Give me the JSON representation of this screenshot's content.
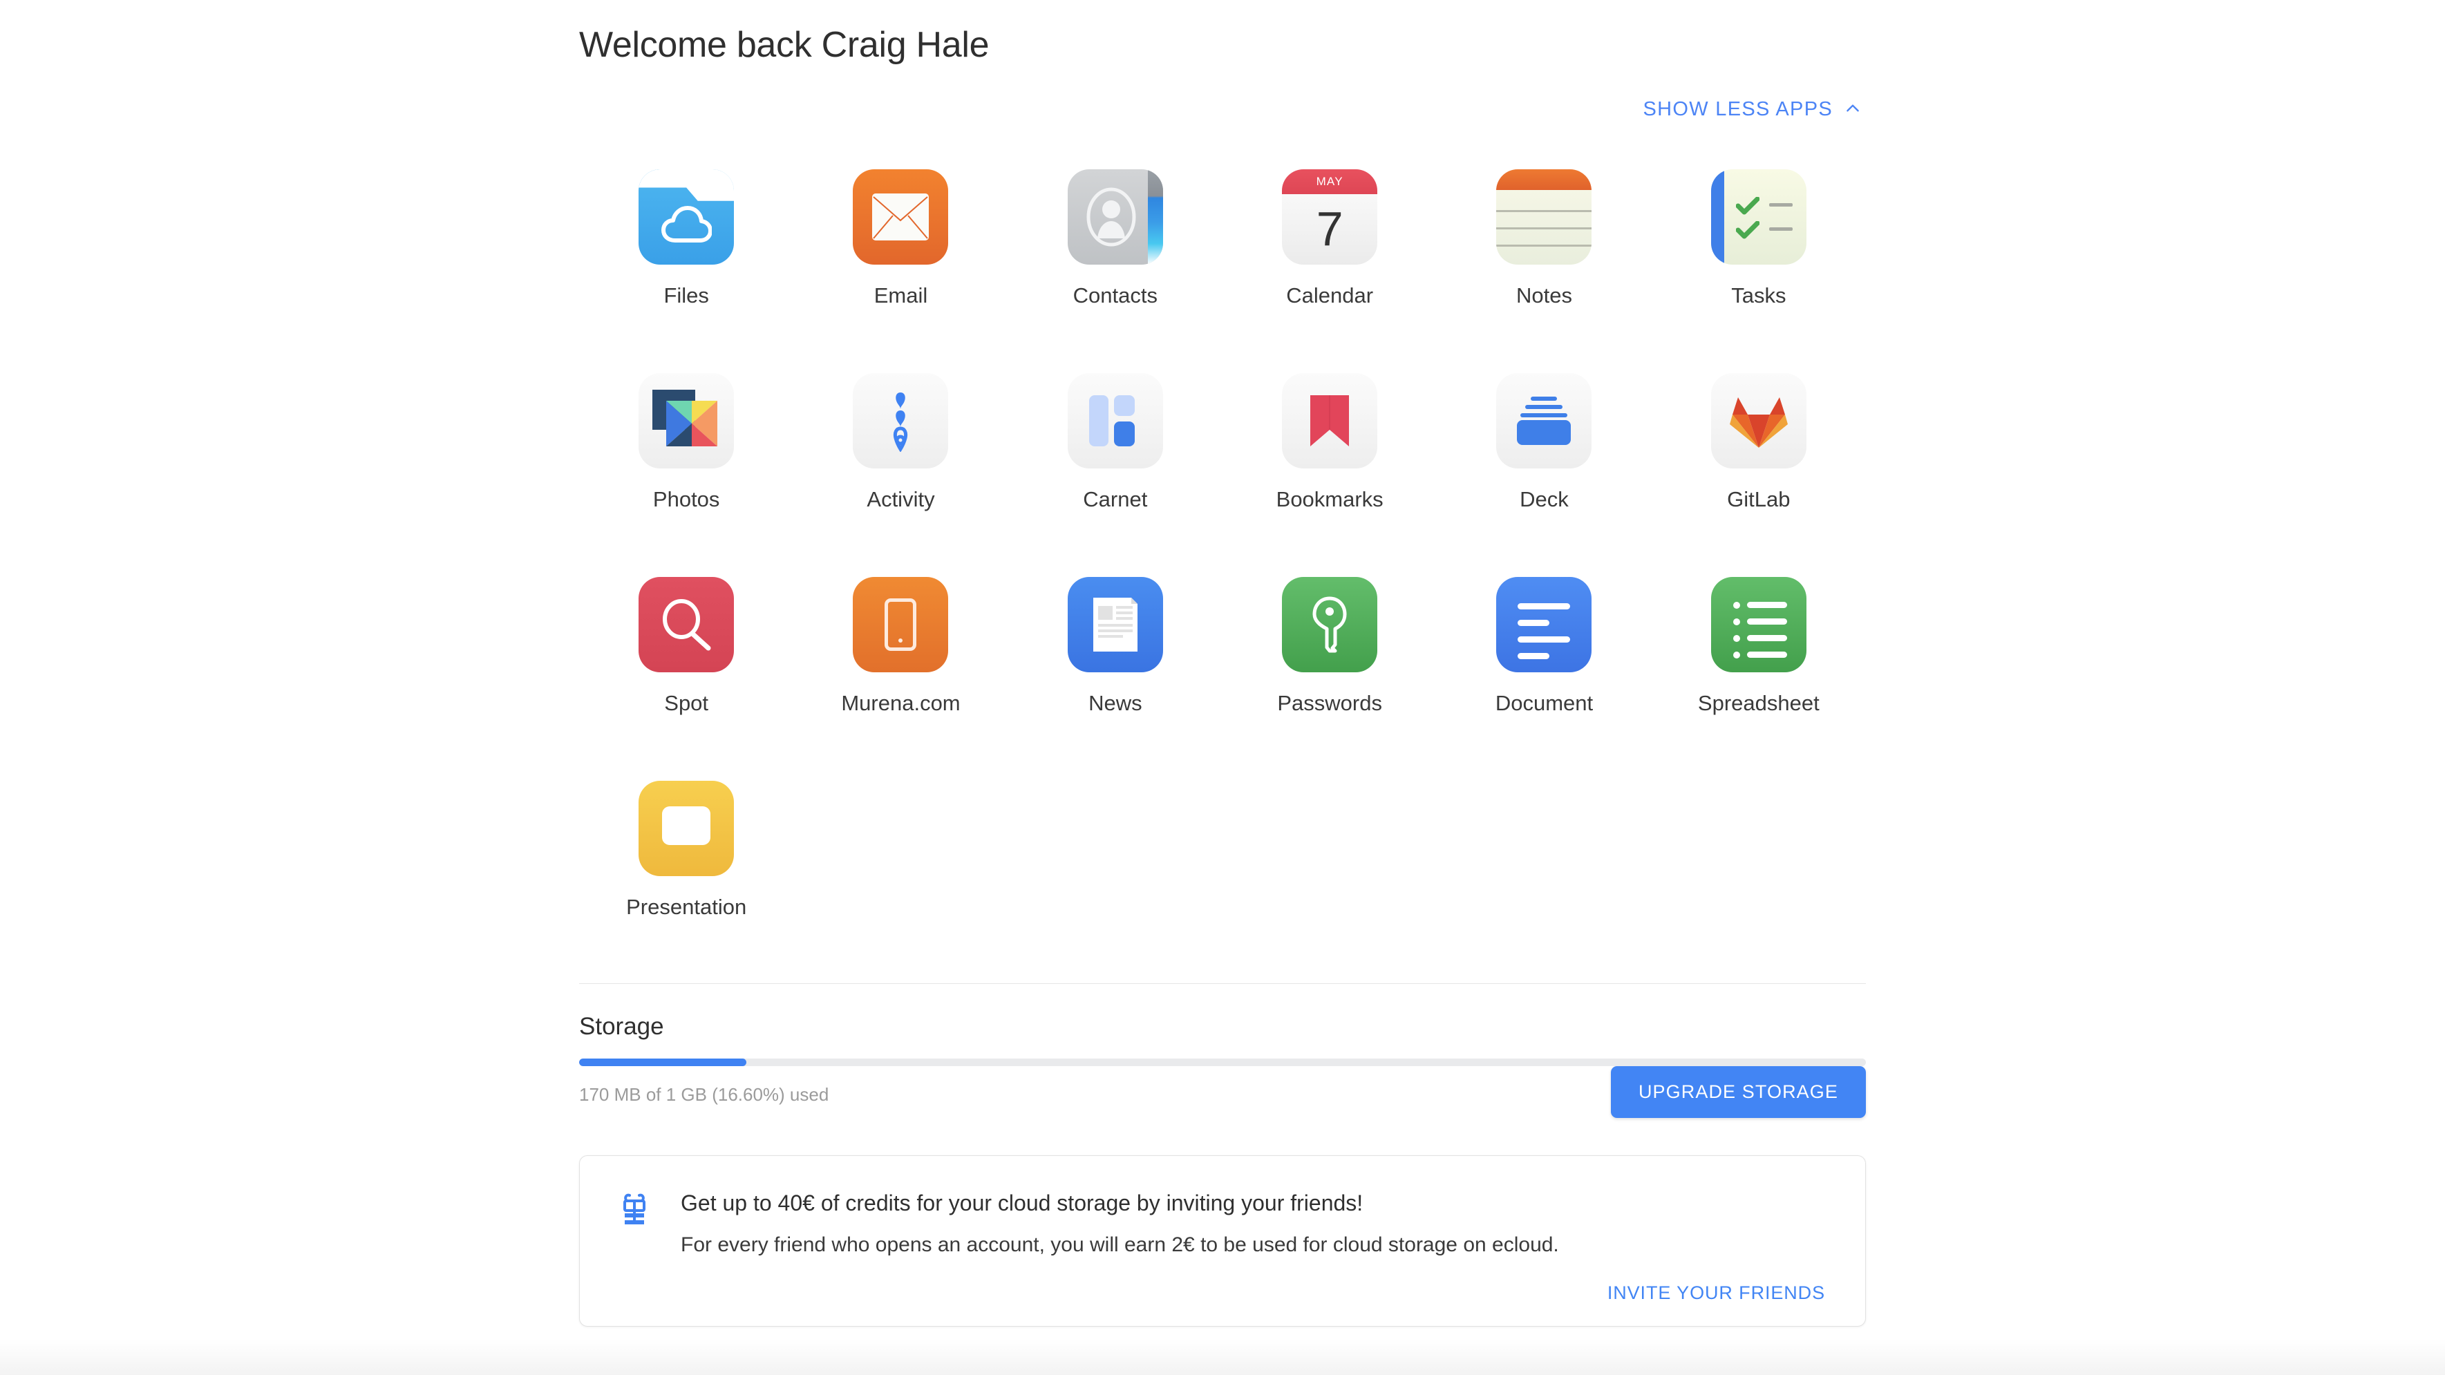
{
  "header": {
    "welcome_title": "Welcome back Craig Hale",
    "show_apps_label": "SHOW LESS APPS",
    "show_apps_icon": "chevron-up-icon"
  },
  "colors": {
    "accent_blue": "#4285f4",
    "link_blue": "#4c84f5",
    "progress_fill": "#3f82f2",
    "progress_track": "#e9eaec",
    "text_primary": "#2f2f2f",
    "text_muted": "#9b9b9b"
  },
  "apps": [
    {
      "label": "Files",
      "icon": "files-icon"
    },
    {
      "label": "Email",
      "icon": "email-icon"
    },
    {
      "label": "Contacts",
      "icon": "contacts-icon"
    },
    {
      "label": "Calendar",
      "icon": "calendar-icon",
      "month": "MAY",
      "day": "7"
    },
    {
      "label": "Notes",
      "icon": "notes-icon"
    },
    {
      "label": "Tasks",
      "icon": "tasks-icon"
    },
    {
      "label": "Photos",
      "icon": "photos-icon"
    },
    {
      "label": "Activity",
      "icon": "activity-icon"
    },
    {
      "label": "Carnet",
      "icon": "carnet-icon"
    },
    {
      "label": "Bookmarks",
      "icon": "bookmarks-icon"
    },
    {
      "label": "Deck",
      "icon": "deck-icon"
    },
    {
      "label": "GitLab",
      "icon": "gitlab-icon"
    },
    {
      "label": "Spot",
      "icon": "spot-search-icon"
    },
    {
      "label": "Murena.com",
      "icon": "murena-phone-icon"
    },
    {
      "label": "News",
      "icon": "news-icon"
    },
    {
      "label": "Passwords",
      "icon": "passwords-key-icon"
    },
    {
      "label": "Document",
      "icon": "document-icon"
    },
    {
      "label": "Spreadsheet",
      "icon": "spreadsheet-icon"
    },
    {
      "label": "Presentation",
      "icon": "presentation-icon"
    }
  ],
  "storage": {
    "section_title": "Storage",
    "used_text": "170 MB of 1 GB (16.60%) used",
    "used_percent": 16.6,
    "bar_fill_percent": 13.0,
    "upgrade_label": "UPGRADE STORAGE"
  },
  "invite": {
    "icon": "gift-icon",
    "headline": "Get up to 40€ of credits for your cloud storage by inviting your friends!",
    "subtext": "For every friend who opens an account, you will earn 2€ to be used for cloud storage on ecloud.",
    "cta_label": "INVITE YOUR FRIENDS"
  }
}
